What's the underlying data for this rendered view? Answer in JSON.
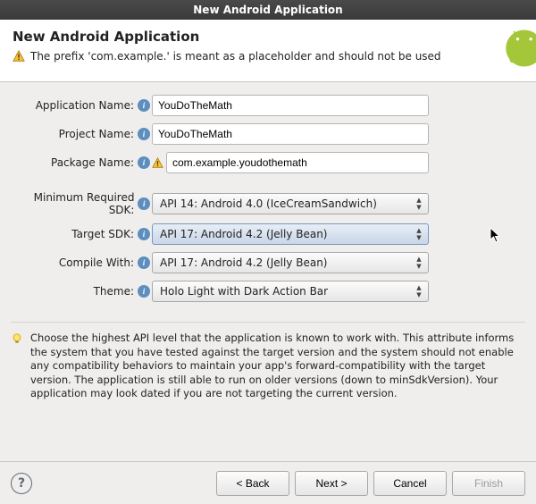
{
  "window": {
    "title": "New Android Application"
  },
  "header": {
    "title": "New Android Application",
    "warning": "The prefix 'com.example.' is meant as a placeholder and should not be used"
  },
  "form": {
    "app_name_label": "Application Name:",
    "app_name_value": "YouDoTheMath",
    "project_name_label": "Project Name:",
    "project_name_value": "YouDoTheMath",
    "package_name_label": "Package Name:",
    "package_name_value": "com.example.youdothemath",
    "min_sdk_label": "Minimum Required SDK:",
    "min_sdk_value": "API 14: Android 4.0 (IceCreamSandwich)",
    "target_sdk_label": "Target SDK:",
    "target_sdk_value": "API 17: Android 4.2 (Jelly Bean)",
    "compile_label": "Compile With:",
    "compile_value": "API 17: Android 4.2 (Jelly Bean)",
    "theme_label": "Theme:",
    "theme_value": "Holo Light with Dark Action Bar"
  },
  "hint": "Choose the highest API level that the application is known to work with. This attribute informs the system that you have tested against the target version and the system should not enable any compatibility behaviors to maintain your app's forward-compatibility with the target version. The application is still able to run on older versions (down to minSdkVersion). Your application may look dated if you are not targeting the current version.",
  "footer": {
    "back": "< Back",
    "next": "Next >",
    "cancel": "Cancel",
    "finish": "Finish"
  }
}
